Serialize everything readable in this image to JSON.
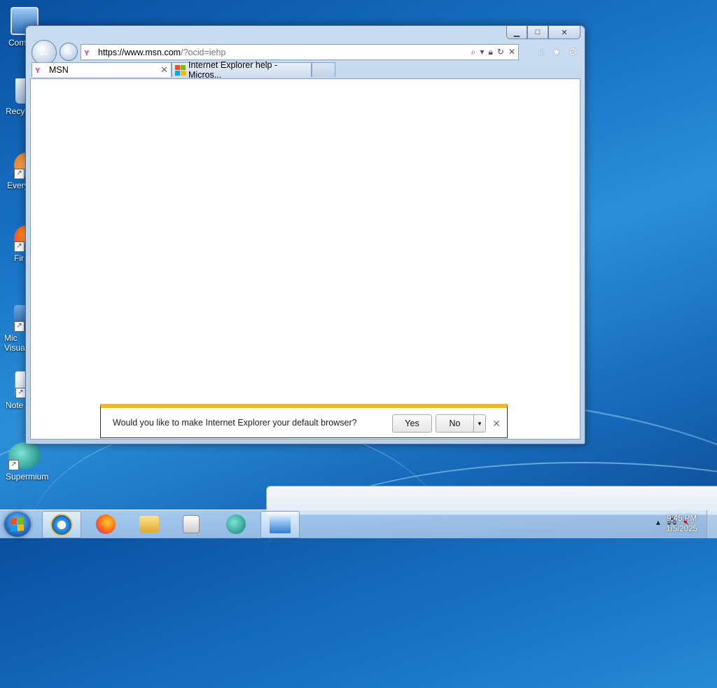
{
  "desktop": {
    "icons": [
      {
        "label": "Computer",
        "short": "Com"
      },
      {
        "label": "Recycle Bin",
        "short": "Recy"
      },
      {
        "label": "Everything",
        "short": "Every"
      },
      {
        "label": "Firefox",
        "short": "Fir"
      },
      {
        "label": "Microsoft Visual Studio",
        "short": "Mic Visual"
      },
      {
        "label": "Notepad++",
        "short": "Note"
      },
      {
        "label": "Supermium",
        "short": "Supermium"
      }
    ]
  },
  "browser": {
    "address": {
      "scheme": "https://",
      "domain": "www.msn.com",
      "rest": "/?ocid=iehp"
    },
    "tabs": [
      {
        "title": "MSN",
        "active": true
      },
      {
        "title": "Internet Explorer help - Micros...",
        "active": false
      }
    ],
    "icons": {
      "back": "back-arrow-icon",
      "forward": "forward-arrow-icon",
      "home": "home-icon",
      "favorites": "star-icon",
      "tools": "gear-icon"
    }
  },
  "notification": {
    "message": "Would you like to make Internet Explorer your default browser?",
    "yes": "Yes",
    "no": "No"
  },
  "taskbar": {
    "apps": [
      "Internet Explorer",
      "Firefox",
      "File Explorer",
      "Windows Media Player",
      "Supermium",
      "Remote Desktop"
    ],
    "clock_time": "9:45 PM",
    "clock_date": "1/5/2025"
  },
  "colors": {
    "notification_accent": "#f3b91e",
    "desktop_blue": "#1a76c8"
  }
}
